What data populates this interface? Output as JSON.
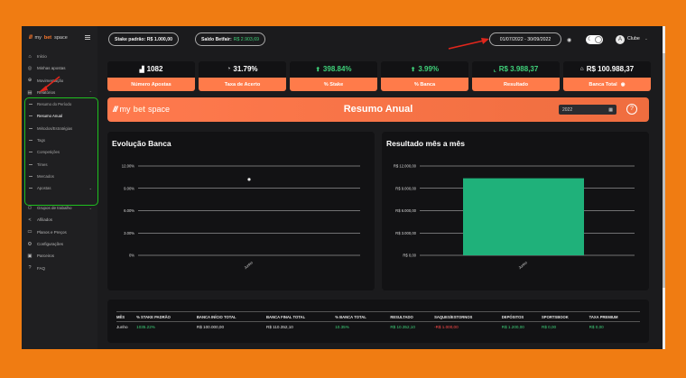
{
  "brand": {
    "my": "my",
    "bet": "bet",
    "space": "space"
  },
  "sidebar": {
    "items": [
      {
        "label": "Início",
        "icon": "home-icon"
      },
      {
        "label": "Minhas apostas",
        "icon": "bets-icon"
      },
      {
        "label": "Movimentação",
        "icon": "transfer-icon"
      },
      {
        "label": "Relatórios",
        "icon": "report-icon"
      }
    ],
    "reports_sub": [
      {
        "label": "Resumo do Período"
      },
      {
        "label": "Resumo Anual"
      },
      {
        "label": "Métodos/Estratégias"
      },
      {
        "label": "Tags"
      },
      {
        "label": "Competições"
      },
      {
        "label": "Times"
      },
      {
        "label": "Mercados"
      },
      {
        "label": "Apostas"
      }
    ],
    "items2": [
      {
        "label": "Grupos de trabalho",
        "icon": "group-icon"
      },
      {
        "label": "Afiliados",
        "icon": "share-icon"
      },
      {
        "label": "Planos e Preços",
        "icon": "plans-icon"
      },
      {
        "label": "Configurações",
        "icon": "gear-icon"
      },
      {
        "label": "Parceiros",
        "icon": "partners-icon"
      },
      {
        "label": "FAQ",
        "icon": "help-icon"
      }
    ]
  },
  "header": {
    "stake_label": "Stake padrão: R$ 1.000,00",
    "saldo_label": "Saldo Betfair:",
    "saldo_value": "R$ 2.903,69",
    "date_range": "01/07/2022 - 30/09/2022",
    "user": "Clube",
    "avatar_letter": "A"
  },
  "kpis": [
    {
      "value": "1082",
      "label": "Número Apostas",
      "icon": "chart-icon"
    },
    {
      "value": "31.79%",
      "label": "Taxa de Acerto",
      "icon": "gauge-icon"
    },
    {
      "value": "398.84%",
      "label": "% Stake",
      "icon": "up-arrow-icon"
    },
    {
      "value": "3.99%",
      "label": "% Banca",
      "icon": "up-arrow-icon"
    },
    {
      "value": "R$ 3.988,37",
      "label": "Resultado",
      "icon": "line-chart-icon"
    },
    {
      "value": "R$ 100.988,37",
      "label": "Banca Total",
      "icon": "bank-icon"
    }
  ],
  "banner": {
    "title": "Resumo Anual",
    "year": "2022"
  },
  "chart_data": [
    {
      "type": "line",
      "title": "Evolução Banca",
      "categories": [
        "Junho"
      ],
      "y_ticks": [
        "12.00%",
        "9.00%",
        "6.00%",
        "3.00%",
        "0%"
      ],
      "ylim": [
        0,
        12
      ],
      "series": [
        {
          "values": [
            10.2
          ]
        }
      ],
      "grid": true
    },
    {
      "type": "bar",
      "title": "Resultado mês a mês",
      "categories": [
        "Junho"
      ],
      "y_ticks": [
        "R$ 12.000,00",
        "R$ 9.000,00",
        "R$ 6.000,00",
        "R$ 3.000,00",
        "R$ 0,00"
      ],
      "ylim": [
        0,
        12000
      ],
      "series": [
        {
          "values": [
            10352.1
          ]
        }
      ],
      "color": "#1fb17a",
      "grid": true
    }
  ],
  "table": {
    "headers": [
      "MÊS",
      "% STAKE PADRÃO",
      "BANCA INÍCIO TOTAL",
      "BANCA FINAL TOTAL",
      "% BANCA TOTAL",
      "RESULTADO",
      "SAQUES/ESTORNOS",
      "DEPÓSITOS",
      "SPORTSBOOK",
      "TAXA PREMIUM"
    ],
    "rows": [
      [
        "Junho",
        "1035.22%",
        "R$ 100.000,00",
        "R$ 110.352,10",
        "10.35%",
        "R$ 10.352,10",
        "-R$ 1.000,00",
        "R$ 1.200,00",
        "R$ 0,00",
        "R$ 0,00"
      ]
    ]
  },
  "colors": {
    "accent": "#ff7b4a",
    "positive": "#3fd17a",
    "negative": "#ff4b4b",
    "highlight": "#1fc01f",
    "annotation": "#e0261c"
  }
}
